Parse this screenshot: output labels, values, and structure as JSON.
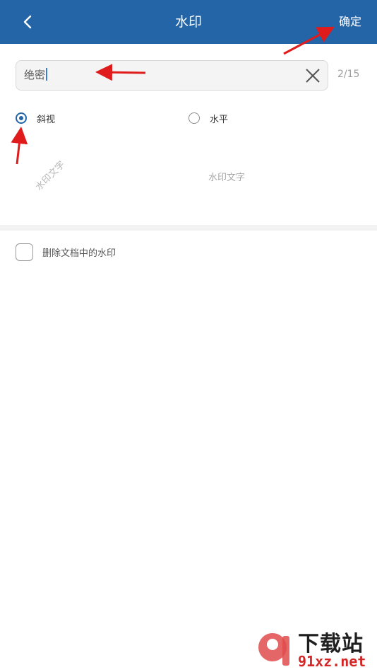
{
  "header": {
    "title": "水印",
    "confirm_label": "确定"
  },
  "watermark_input": {
    "value": "绝密",
    "counter": "2/15"
  },
  "orientation": {
    "options": [
      {
        "label": "斜视",
        "selected": true
      },
      {
        "label": "水平",
        "selected": false
      }
    ]
  },
  "preview": {
    "diagonal_text": "水印文字",
    "horizontal_text": "水印文字"
  },
  "remove_option": {
    "label": "删除文档中的水印",
    "checked": false
  },
  "site_logo": {
    "top_text": "下载站",
    "bottom_text": "91xz.net"
  },
  "colors": {
    "header_bg": "#2465a8",
    "accent": "#2465a8",
    "arrow": "#e01b1b"
  }
}
